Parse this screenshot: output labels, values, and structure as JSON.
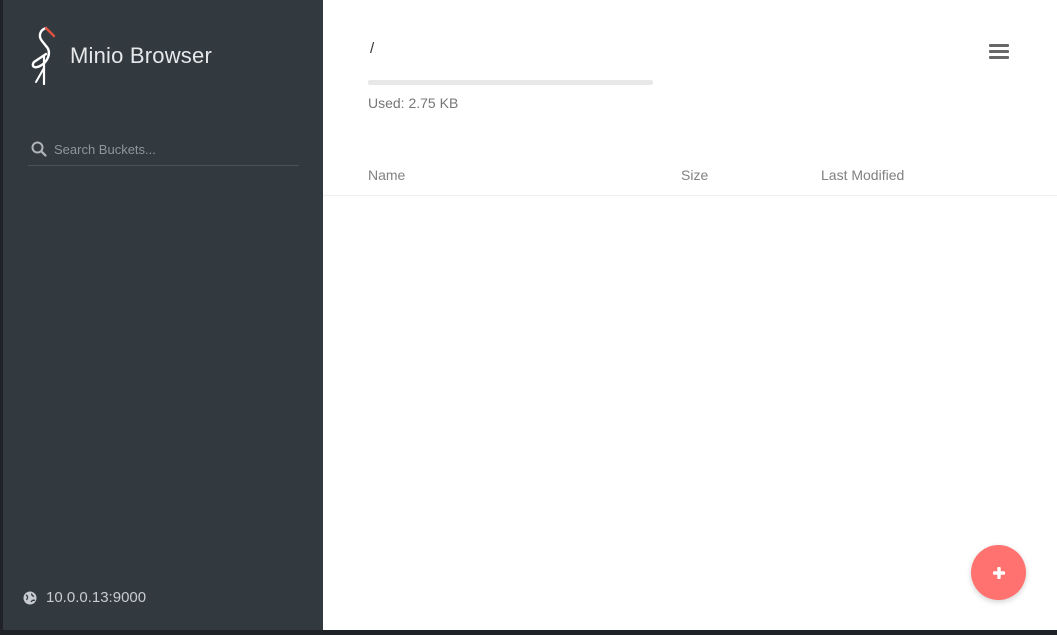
{
  "app": {
    "title": "Minio Browser",
    "brand_accent": "#ff726f",
    "sidebar_color": "#32393f"
  },
  "sidebar": {
    "search": {
      "placeholder": "Search Buckets...",
      "value": "",
      "icon": "search-icon"
    },
    "host": {
      "icon": "globe-icon",
      "address": "10.0.0.13:9000"
    }
  },
  "main": {
    "path": "/",
    "usage": {
      "label": "Used: 2.75 KB",
      "fraction": 0
    },
    "menu_icon": "hamburger-menu-icon",
    "table": {
      "columns": [
        "Name",
        "Size",
        "Last Modified"
      ],
      "rows": []
    },
    "fab": {
      "icon": "plus-icon"
    }
  }
}
